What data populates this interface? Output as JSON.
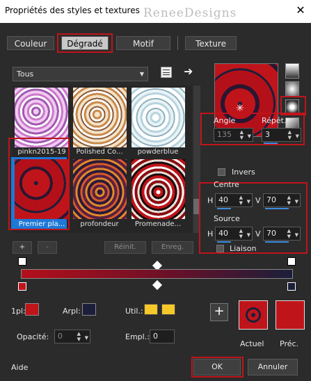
{
  "window": {
    "title": "Propriétés des styles et textures",
    "watermark": "ReneeDesigns",
    "close_icon": "close-icon"
  },
  "tabs": [
    {
      "label": "Couleur"
    },
    {
      "label": "Dégradé",
      "active": true
    },
    {
      "label": "Motif"
    },
    {
      "label": "Texture"
    }
  ],
  "category": {
    "value": "Tous"
  },
  "gallery": {
    "items": [
      {
        "label": "pinkn2015-19"
      },
      {
        "label": "Polished Co..."
      },
      {
        "label": "powderblue"
      },
      {
        "label": "Premier pla...",
        "selected": true
      },
      {
        "label": "profondeur"
      },
      {
        "label": "Promenade..."
      }
    ]
  },
  "gallery_buttons": {
    "add": "+",
    "remove": "-",
    "reset": "Réinit.",
    "save": "Enreg."
  },
  "angle": {
    "label": "Angle",
    "value": "135"
  },
  "repeat": {
    "label": "Répét.",
    "value": "3"
  },
  "invert": {
    "label": "Invers",
    "checked": false
  },
  "center": {
    "label": "Centre",
    "h_label": "H",
    "h_value": "40",
    "v_label": "V",
    "v_value": "70"
  },
  "source": {
    "label": "Source",
    "h_label": "H",
    "h_value": "40",
    "v_label": "V",
    "v_value": "70"
  },
  "link": {
    "label": "Liaison",
    "checked": false
  },
  "stops": {
    "fg_label": "1pl:",
    "bg_label": "Arpl:",
    "user_label": "Util.:",
    "opacity_label": "Opacité:",
    "opacity_value": "0",
    "location_label": "Empl.:",
    "location_value": "0"
  },
  "preview": {
    "current_label": "Actuel",
    "previous_label": "Préc."
  },
  "footer": {
    "help": "Aide",
    "ok": "OK",
    "cancel": "Annuler"
  },
  "colors": {
    "accent_red": "#c0141b",
    "dark_red": "#8c1020",
    "navy": "#1b1f3a",
    "yellow": "#f5c82a",
    "selection_blue": "#1e78d7"
  }
}
